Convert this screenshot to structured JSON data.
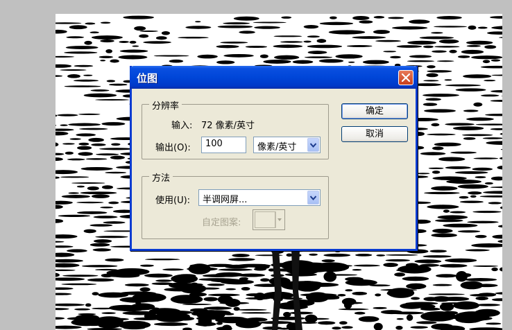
{
  "dialog": {
    "title": "位图",
    "resolution": {
      "legend": "分辨率",
      "input_label": "输入:",
      "input_value": "72 像素/英寸",
      "output_label": "输出(O):",
      "output_value": "100",
      "output_unit": "像素/英寸"
    },
    "method": {
      "legend": "方法",
      "use_label": "使用(U):",
      "use_value": "半调网屏...",
      "custom_pattern_label": "自定图案:"
    },
    "ok_label": "确定",
    "cancel_label": "取消"
  },
  "icons": {
    "close": "close-icon",
    "dropdown": "chevron-down-icon"
  },
  "colors": {
    "titlebar": "#0046d8",
    "dialog_bg": "#ece9d8",
    "close_button": "#d8522c"
  }
}
